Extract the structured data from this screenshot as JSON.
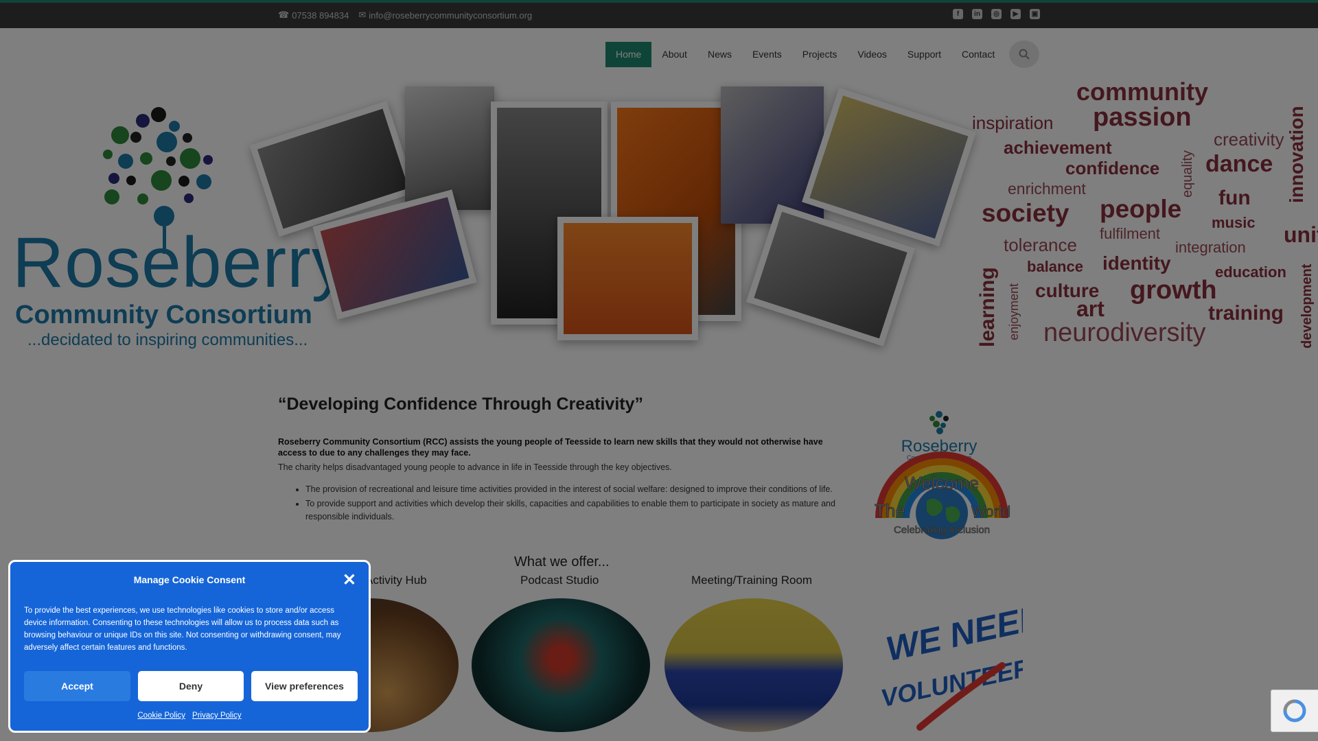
{
  "topbar": {
    "phone": "07538 894834",
    "email": "info@roseberrycommunityconsortium.org",
    "socials": [
      "facebook-icon",
      "linkedin-icon",
      "instagram-icon",
      "youtube-icon",
      "web-icon"
    ]
  },
  "nav": {
    "items": [
      "Home",
      "About",
      "News",
      "Events",
      "Projects",
      "Videos",
      "Support",
      "Contact"
    ],
    "active": "Home"
  },
  "logo": {
    "name": "Roseberry",
    "sub": "Community Consortium",
    "tagline": "...decidated to inspiring communities..."
  },
  "wordcloud": [
    "community",
    "passion",
    "inspiration",
    "creativity",
    "achievement",
    "confidence",
    "dance",
    "innovation",
    "equality",
    "enrichment",
    "society",
    "people",
    "fun",
    "music",
    "fulfilment",
    "unity",
    "tolerance",
    "integration",
    "learning",
    "balance",
    "identity",
    "education",
    "enjoyment",
    "culture",
    "growth",
    "art",
    "training",
    "development",
    "neurodiversity"
  ],
  "content": {
    "quote": "“Developing Confidence Through Creativity”",
    "intro_bold": "Roseberry Community Consortium (RCC) assists the young people of Teesside to learn new skills that they would not otherwise have access to due to any challenges they may face.",
    "intro": "The charity helps disadvantaged young people to advance in life in Teesside through the key objectives.",
    "objectives": [
      "The provision of recreational and leisure time activities provided in the interest of social welfare: designed to improve their conditions of life.",
      "To provide support and activities which develop their skills, capacities and capabilities to enable them to participate in society as mature and responsible individuals."
    ]
  },
  "welcome_badge": {
    "logo_name": "Roseberry",
    "logo_sub": "Community Consortium",
    "welcome": "Welcome",
    "the": "The",
    "world": "World",
    "celebrating": "Celebrating Inclusion"
  },
  "offers": {
    "title": "What we offer...",
    "items": [
      "Activity Hub",
      "Podcast Studio",
      "Meeting/Training Room"
    ]
  },
  "volunteers": {
    "line1": "WE NEED",
    "line2": "VOLUNTEERS"
  },
  "cookie": {
    "title": "Manage Cookie Consent",
    "body": "To provide the best experiences, we use technologies like cookies to store and/or access device information. Consenting to these technologies will allow us to process data such as browsing behaviour or unique IDs on this site. Not consenting or withdrawing consent, may adversely affect certain features and functions.",
    "accept": "Accept",
    "deny": "Deny",
    "preferences": "View preferences",
    "cookie_policy": "Cookie Policy",
    "privacy_policy": "Privacy Policy"
  },
  "colors": {
    "accent": "#1f8a70",
    "brand_blue": "#1d7aa8",
    "word_red": "#8b2f3c",
    "cookie_blue": "#1565d8"
  }
}
